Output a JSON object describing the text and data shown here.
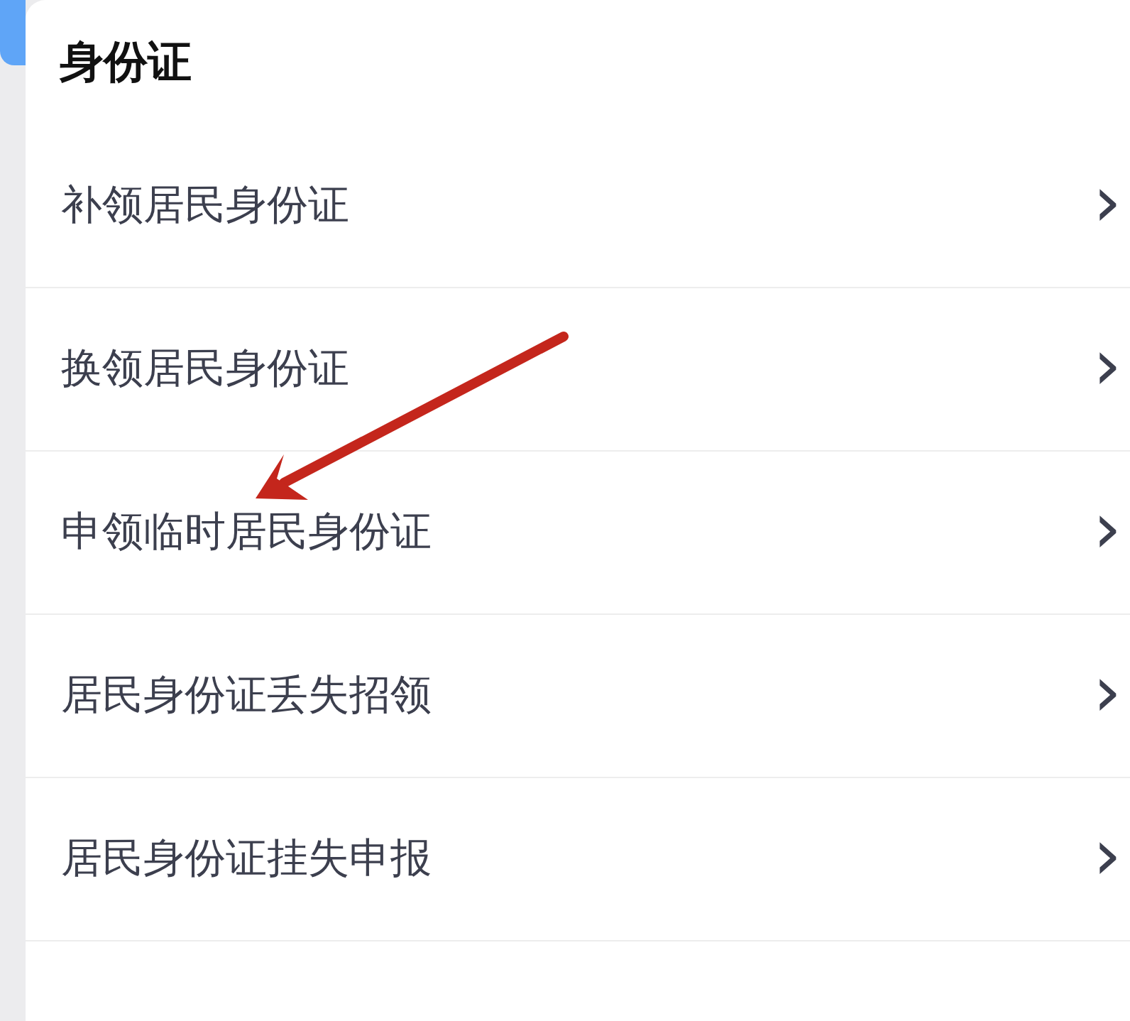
{
  "section": {
    "title": "身份证"
  },
  "items": [
    {
      "label": "补领居民身份证",
      "chevron": "›"
    },
    {
      "label": "换领居民身份证",
      "chevron": "›"
    },
    {
      "label": "申领临时居民身份证",
      "chevron": "›"
    },
    {
      "label": "居民身份证丢失招领",
      "chevron": "›"
    },
    {
      "label": "居民身份证挂失申报",
      "chevron": "›"
    }
  ]
}
